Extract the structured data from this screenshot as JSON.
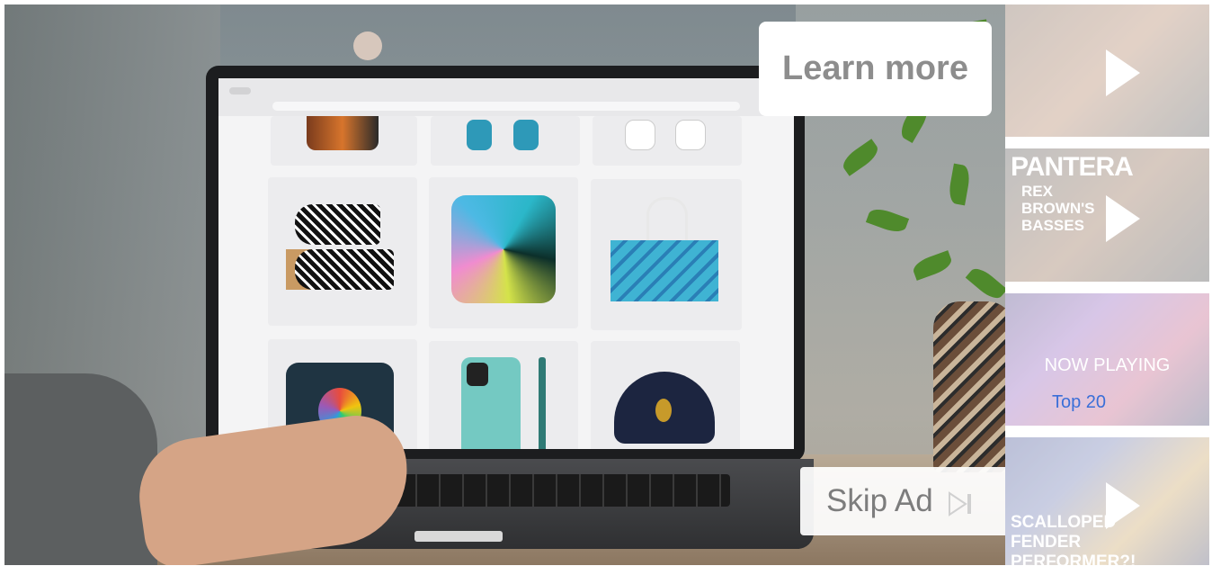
{
  "ad": {
    "learn_more_label": "Learn more",
    "skip_label": "Skip Ad"
  },
  "playlist": [
    {
      "title": "",
      "status": "",
      "icon": "play-icon"
    },
    {
      "title": "PANTERA",
      "subtitle": "REX BROWN'S BASSES",
      "status": "",
      "icon": "play-icon"
    },
    {
      "title": "Top 20",
      "status": "NOW PLAYING",
      "icon": ""
    },
    {
      "title": "SCALLOPED FENDER PERFORMER?!",
      "status": "",
      "icon": "play-icon"
    }
  ],
  "colors": {
    "button_text": "#8d8d8d",
    "button_bg": "#ffffff"
  }
}
